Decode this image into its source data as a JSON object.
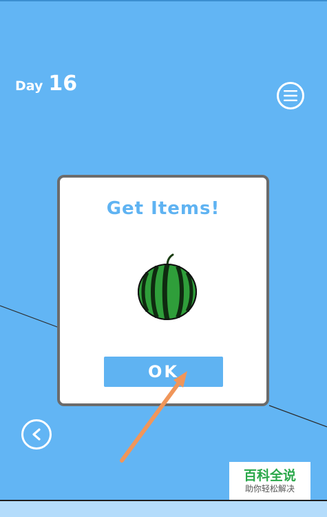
{
  "hud": {
    "day_word": "Day",
    "day_number": "16"
  },
  "icons": {
    "menu": "menu-icon",
    "back": "back-arrow-icon",
    "item": "watermelon-icon",
    "pointer": "orange-arrow-icon"
  },
  "dialog": {
    "title": "Get Items!",
    "ok_label": "OK"
  },
  "watermark": {
    "title": "百科全说",
    "subtitle": "助你轻松解决"
  },
  "colors": {
    "background": "#62b5f4",
    "accent": "#5fb3f2",
    "dialog_border": "#6b6b6b",
    "arrow": "#f0965a",
    "watermark_green": "#2aa84a"
  }
}
